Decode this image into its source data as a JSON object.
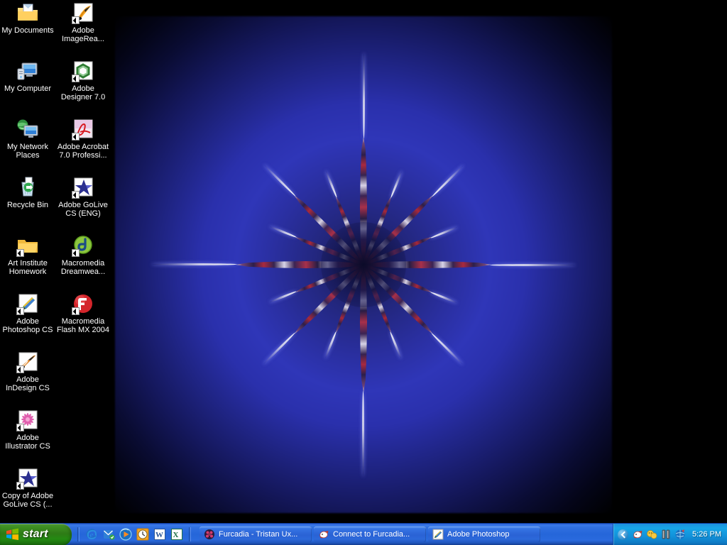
{
  "desktop": {
    "icons": [
      {
        "label": "My Documents",
        "icon": "my-documents-folder-icon",
        "shortcut": false,
        "col": 0,
        "row": 0
      },
      {
        "label": "Adobe ImageRea...",
        "icon": "adobe-imageready-icon",
        "shortcut": true,
        "col": 1,
        "row": 0
      },
      {
        "label": "My Computer",
        "icon": "my-computer-icon",
        "shortcut": false,
        "col": 0,
        "row": 1
      },
      {
        "label": "Adobe Designer 7.0",
        "icon": "adobe-designer-icon",
        "shortcut": true,
        "col": 1,
        "row": 1
      },
      {
        "label": "My Network Places",
        "icon": "my-network-places-icon",
        "shortcut": false,
        "col": 0,
        "row": 2
      },
      {
        "label": "Adobe Acrobat 7.0 Professi...",
        "icon": "adobe-acrobat-icon",
        "shortcut": true,
        "col": 1,
        "row": 2
      },
      {
        "label": "Recycle Bin",
        "icon": "recycle-bin-icon",
        "shortcut": false,
        "col": 0,
        "row": 3
      },
      {
        "label": "Adobe GoLive CS (ENG)",
        "icon": "adobe-golive-icon",
        "shortcut": true,
        "col": 1,
        "row": 3
      },
      {
        "label": "Art Institute Homework",
        "icon": "folder-icon",
        "shortcut": true,
        "col": 0,
        "row": 4
      },
      {
        "label": "Macromedia Dreamwea...",
        "icon": "macromedia-dreamweaver-icon",
        "shortcut": true,
        "col": 1,
        "row": 4
      },
      {
        "label": "Adobe Photoshop CS",
        "icon": "adobe-photoshop-icon",
        "shortcut": true,
        "col": 0,
        "row": 5
      },
      {
        "label": "Macromedia Flash MX 2004",
        "icon": "macromedia-flash-icon",
        "shortcut": true,
        "col": 1,
        "row": 5
      },
      {
        "label": "Adobe InDesign CS",
        "icon": "adobe-indesign-icon",
        "shortcut": true,
        "col": 0,
        "row": 6
      },
      {
        "label": "Adobe Illustrator CS",
        "icon": "adobe-illustrator-icon",
        "shortcut": true,
        "col": 0,
        "row": 7
      },
      {
        "label": "Copy of Adobe GoLive CS (...",
        "icon": "adobe-golive-icon",
        "shortcut": true,
        "col": 0,
        "row": 8
      }
    ]
  },
  "taskbar": {
    "start_label": "start",
    "quicklaunch": [
      {
        "name": "internet-explorer-icon"
      },
      {
        "name": "outlook-express-icon"
      },
      {
        "name": "windows-media-player-icon"
      },
      {
        "name": "clock-icon"
      },
      {
        "name": "microsoft-word-icon"
      },
      {
        "name": "microsoft-excel-icon"
      }
    ],
    "windows": [
      {
        "label": "Furcadia - Tristan Ux...",
        "icon": "furcadia-icon",
        "active": false
      },
      {
        "label": "Connect to Furcadia...",
        "icon": "furcadia-dog-icon",
        "active": false
      },
      {
        "label": "Adobe Photoshop",
        "icon": "adobe-photoshop-icon",
        "active": false
      }
    ],
    "tray": {
      "chevron": "show-hidden-icons-chevron",
      "icons": [
        {
          "name": "furcadia-dog-tray-icon"
        },
        {
          "name": "messenger-tray-icon"
        },
        {
          "name": "battery-tray-icon"
        },
        {
          "name": "network-tray-icon"
        }
      ],
      "clock": "5:26 PM"
    }
  },
  "colors": {
    "taskbar_blue": "#2566d9",
    "start_green": "#2e7b16",
    "tray_blue": "#1293db",
    "wallpaper_glow": "#2f36b8",
    "desktop_black": "#000000"
  }
}
